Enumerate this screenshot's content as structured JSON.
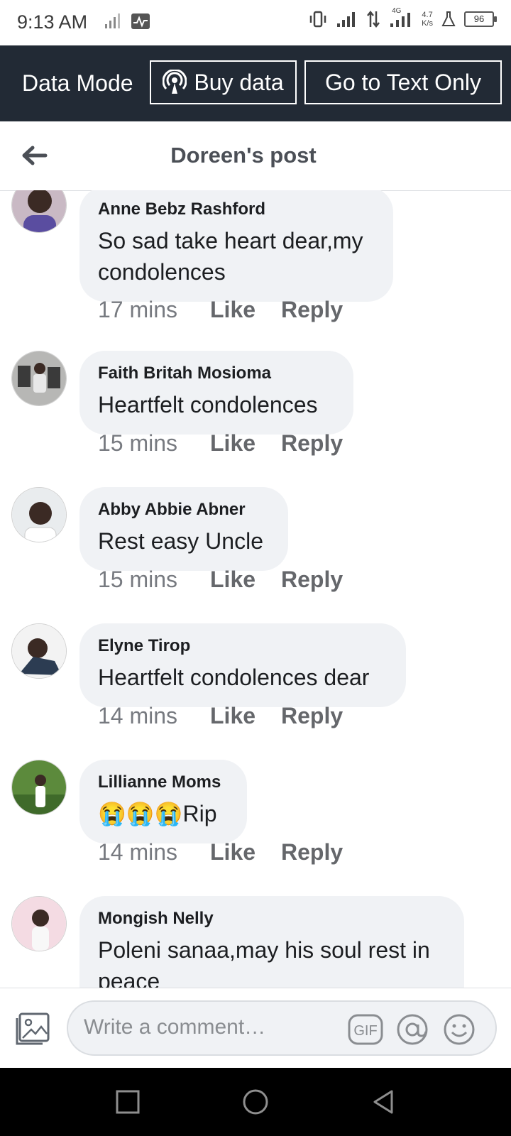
{
  "status_bar": {
    "time": "9:13 AM",
    "network_speed_value": "4.7",
    "network_speed_unit": "K/s",
    "battery": "96",
    "network_type": "4G"
  },
  "data_bar": {
    "label": "Data Mode",
    "buy_data": "Buy data",
    "text_only": "Go to Text Only"
  },
  "header": {
    "title": "Doreen's post"
  },
  "comments": [
    {
      "name": "Anne Bebz Rashford",
      "text": "So sad take heart dear,my condolences",
      "time": "17 mins",
      "like": "Like",
      "reply": "Reply"
    },
    {
      "name": "Faith Britah Mosioma",
      "text": "Heartfelt condolences",
      "time": "15 mins",
      "like": "Like",
      "reply": "Reply"
    },
    {
      "name": "Abby Abbie Abner",
      "text": "Rest easy Uncle",
      "time": "15 mins",
      "like": "Like",
      "reply": "Reply"
    },
    {
      "name": "Elyne Tirop",
      "text": "Heartfelt condolences dear",
      "time": "14 mins",
      "like": "Like",
      "reply": "Reply"
    },
    {
      "name": "Lillianne Moms",
      "text": "😭😭😭Rip",
      "time": "14 mins",
      "like": "Like",
      "reply": "Reply"
    },
    {
      "name": "Mongish Nelly",
      "text": "Poleni sanaa,may his soul rest in peace",
      "time": "",
      "like": "",
      "reply": ""
    }
  ],
  "composer": {
    "placeholder": "Write a comment…",
    "gif_label": "GIF"
  },
  "colors": {
    "data_bar_bg": "#222a35",
    "bubble_bg": "#f0f2f5",
    "meta_text": "#65676b"
  }
}
